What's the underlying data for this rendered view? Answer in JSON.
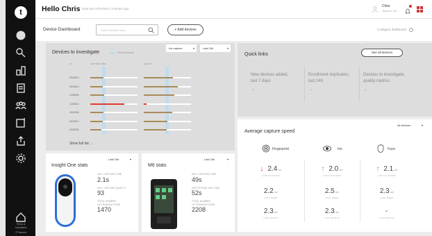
{
  "topbar": {
    "greeting": "Hello Chris",
    "refreshed": "Data last refreshed 2 minutes ago",
    "user_name": "Chris",
    "user_org": "Tascent, Inc."
  },
  "subbar": {
    "title": "Device Dashboard",
    "search_placeholder": "Search device name",
    "add_devices": "+ Add devices",
    "configure": "Configure dashboard"
  },
  "sidebar": {
    "footer_line1": "Terms &",
    "footer_line2": "Conditions",
    "footer_line3": "© Tascent"
  },
  "investigate": {
    "title": "Devices to investigate",
    "legend": "Mid benchmark",
    "filter1": "Iris capture",
    "filter2": "Last 24h",
    "col_id": "ID",
    "col_capture": "CAPTURE TIME",
    "col_quality": "QUALITY",
    "show_full": "Show full list  →",
    "rows": [
      {
        "id": "0918012",
        "capture": 0.28,
        "quality": 0.62,
        "alert": false
      },
      {
        "id": "0918014",
        "capture": 0.26,
        "quality": 0.72,
        "alert": false
      },
      {
        "id": "1236004",
        "capture": 0.3,
        "quality": 0.64,
        "alert": false
      },
      {
        "id": "1236014",
        "capture": 0.72,
        "quality": 0.06,
        "alert": true
      },
      {
        "id": "1516004",
        "capture": 0.28,
        "quality": 0.6,
        "alert": false
      },
      {
        "id": "0918012",
        "capture": 0.26,
        "quality": 0.5,
        "alert": false
      },
      {
        "id": "0918024",
        "capture": 0.24,
        "quality": 0.48,
        "alert": false
      }
    ]
  },
  "quicklinks": {
    "title": "Quick links",
    "see_all": "See all devices",
    "items": [
      {
        "line1": "New devices added,",
        "line2": "last 7 days",
        "arrow": "→"
      },
      {
        "line1": "Enrollment duplicates,",
        "line2": "last 24h",
        "arrow": "→"
      },
      {
        "line1": "Devices to investigate,",
        "line2": "quality metrics",
        "arrow": "→"
      }
    ]
  },
  "speed": {
    "title": "Average capture speed",
    "filter": "All devices",
    "modalities": [
      "Fingerprint",
      "Iris",
      "Face"
    ],
    "columns": [
      {
        "trend": "down",
        "values": [
          {
            "v": "2.4",
            "u": "sec",
            "c": "LAST 24 HOURS"
          },
          {
            "v": "2.2",
            "u": "sec",
            "c": "LAST WEEK"
          },
          {
            "v": "2.3",
            "u": "sec",
            "c": "LAST MONTH"
          }
        ]
      },
      {
        "trend": "up",
        "values": [
          {
            "v": "2.0",
            "u": "sec",
            "c": "LAST 24 HOURS"
          },
          {
            "v": "2.5",
            "u": "sec",
            "c": "LAST WEEK"
          },
          {
            "v": "2.3",
            "u": "sec",
            "c": "LAST MONTH"
          }
        ]
      },
      {
        "trend": "up",
        "values": [
          {
            "v": "2.1",
            "u": "sec",
            "c": "LAST 24 HOURS"
          },
          {
            "v": "2.3",
            "u": "sec",
            "c": "LAST WEEK"
          },
          {
            "v": "-",
            "u": "",
            "c": "LAST MONTH"
          }
        ]
      }
    ]
  },
  "insight": {
    "title": "Insight One stats",
    "filter": "Last 24h",
    "stats": [
      {
        "label1": "AVG. CAPTURE TIME",
        "label2": "",
        "value": "2.1s"
      },
      {
        "label1": "AVG. CAPTURE QUALITY",
        "label2": "",
        "value": "93"
      },
      {
        "label1": "TOTAL NUMBER",
        "label2": "OF TRANSACTIONS",
        "value": "1470"
      }
    ]
  },
  "m6": {
    "title": "M6 stats",
    "filter": "Last 24h",
    "stats": [
      {
        "label1": "AVG. CAPTURE TIME",
        "label2": "",
        "value": "49s"
      },
      {
        "label1": "INSTITUTION: AVG TIME",
        "label2": "",
        "value": "52s"
      },
      {
        "label1": "TOTAL NUMBER",
        "label2": "OF TRANSACTIONS",
        "value": "2208"
      }
    ]
  },
  "colors": {
    "accent_red": "#e03a2f",
    "bar_brown": "#a88a5a",
    "benchmark": "#bfdcee",
    "up": "#4caf50"
  }
}
